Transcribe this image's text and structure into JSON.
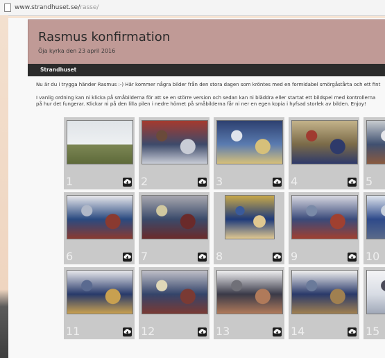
{
  "browser": {
    "url_host": "www.strandhuset.se/",
    "url_path": "rasse/"
  },
  "header": {
    "title": "Rasmus konfirmation",
    "subtitle": "Öja kyrka den 23 april 2016"
  },
  "nav": {
    "item": "Strandhuset"
  },
  "intro": {
    "line1": "Nu är du i trygga händer Rasmus :-) Här kommer några bilder från den stora dagen som kröntes med en formidabel smörgåstårta och ett fint",
    "line2": "I vanlig ordning kan ni klicka på småbilderna för att se en större version och sedan kan ni bläddra eller startat ett bildspel med kontrollerna",
    "line3": "på hur det fungerar. Klickar ni på den lilla pilen i nedre hörnet på småbilderna får ni ner en egen kopia i hyfsad storlek av bilden. Enjoy!"
  },
  "gallery": {
    "tiles": [
      {
        "num": "1",
        "scene": "church-exterior"
      },
      {
        "num": "2",
        "scene": "church-aisle"
      },
      {
        "num": "3",
        "scene": "organ"
      },
      {
        "num": "4",
        "scene": "altar"
      },
      {
        "num": "5",
        "scene": "pews"
      },
      {
        "num": "6",
        "scene": "procession"
      },
      {
        "num": "7",
        "scene": "congregation"
      },
      {
        "num": "8",
        "scene": "altar-close"
      },
      {
        "num": "9",
        "scene": "ceremony"
      },
      {
        "num": "10",
        "scene": "window"
      },
      {
        "num": "11",
        "scene": "confirmands"
      },
      {
        "num": "12",
        "scene": "crowd"
      },
      {
        "num": "13",
        "scene": "choir"
      },
      {
        "num": "14",
        "scene": "group"
      },
      {
        "num": "15",
        "scene": "portrait"
      }
    ],
    "download_icon": "cloud-download-icon"
  },
  "colors": {
    "header_bg": "#c09a96",
    "nav_bg": "#2b2b2b",
    "tile_bg": "#c9c9c9"
  }
}
